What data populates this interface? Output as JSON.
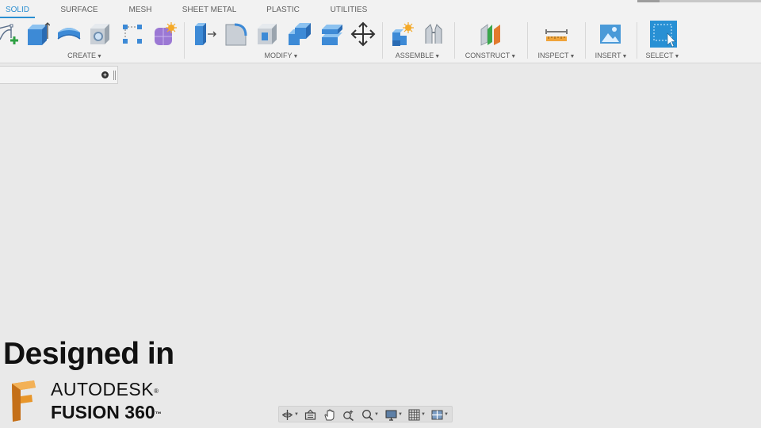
{
  "ribbon": {
    "tabs": [
      {
        "label": "SOLID",
        "active": true
      },
      {
        "label": "SURFACE",
        "active": false
      },
      {
        "label": "MESH",
        "active": false
      },
      {
        "label": "SHEET METAL",
        "active": false
      },
      {
        "label": "PLASTIC",
        "active": false
      },
      {
        "label": "UTILITIES",
        "active": false
      }
    ],
    "groups": {
      "create": "CREATE",
      "modify": "MODIFY",
      "assemble": "ASSEMBLE",
      "construct": "CONSTRUCT",
      "inspect": "INSPECT",
      "insert": "INSERT",
      "select": "SELECT"
    },
    "accent_color": "#2a8fd1",
    "icon_blue": "#4a90d9"
  },
  "tools": {
    "create": [
      "create-sketch-icon",
      "extrude-icon",
      "revolve-icon",
      "hole-icon",
      "pattern-icon",
      "create-form-icon"
    ],
    "modify": [
      "press-pull-icon",
      "fillet-icon",
      "shell-icon",
      "combine-icon",
      "offset-face-icon",
      "move-icon"
    ],
    "assemble": [
      "new-component-icon",
      "joint-icon"
    ],
    "construct": [
      "offset-plane-icon"
    ],
    "inspect": [
      "measure-icon"
    ],
    "insert": [
      "insert-image-icon"
    ],
    "select": [
      "select-icon"
    ]
  },
  "branding": {
    "designed_in": "Designed in",
    "company": "AUTODESK",
    "company_mark": "®",
    "product": "FUSION 360",
    "product_mark": "™",
    "logo_color": "#e8962a"
  },
  "navbar": {
    "items": [
      "orbit-icon",
      "look-at-icon",
      "pan-icon",
      "zoom-icon",
      "fit-icon",
      "display-settings-icon",
      "grid-settings-icon",
      "viewports-icon"
    ]
  }
}
